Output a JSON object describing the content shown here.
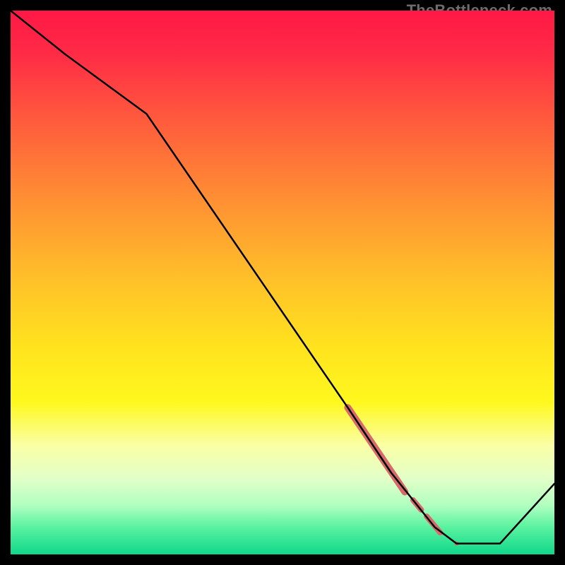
{
  "watermark": "TheBottleneck.com",
  "chart_data": {
    "type": "line",
    "title": "",
    "xlabel": "",
    "ylabel": "",
    "xlim": [
      0,
      100
    ],
    "ylim": [
      0,
      100
    ],
    "grid": false,
    "legend": false,
    "series": [
      {
        "name": "curve",
        "color": "#000000",
        "x": [
          0,
          10,
          25,
          62,
          70,
          74,
          78,
          82,
          90,
          100
        ],
        "y": [
          100,
          92,
          81,
          27,
          15,
          10,
          5,
          2,
          2,
          13
        ]
      }
    ],
    "highlights": [
      {
        "name": "thick-segment-1",
        "x": [
          62,
          72.5
        ],
        "y": [
          27,
          11.5
        ],
        "width": 10,
        "color": "#d76a6a"
      },
      {
        "name": "thick-segment-2",
        "x": [
          74,
          75.5
        ],
        "y": [
          10,
          8.2
        ],
        "width": 8,
        "color": "#d76a6a"
      },
      {
        "name": "thick-segment-3",
        "x": [
          76.5,
          79
        ],
        "y": [
          7,
          4
        ],
        "width": 8,
        "color": "#d76a6a"
      },
      {
        "name": "dot-1",
        "x": [
          82
        ],
        "y": [
          2
        ],
        "width": 6,
        "color": "#d76a6a"
      }
    ],
    "background_gradient": {
      "type": "vertical",
      "stops": [
        {
          "pos": 0.0,
          "color": "#ff1846"
        },
        {
          "pos": 0.08,
          "color": "#ff2b46"
        },
        {
          "pos": 0.2,
          "color": "#ff5a3d"
        },
        {
          "pos": 0.35,
          "color": "#ff9033"
        },
        {
          "pos": 0.5,
          "color": "#ffc229"
        },
        {
          "pos": 0.62,
          "color": "#ffe31e"
        },
        {
          "pos": 0.72,
          "color": "#fff81e"
        },
        {
          "pos": 0.8,
          "color": "#faffa6"
        },
        {
          "pos": 0.86,
          "color": "#e3ffc8"
        },
        {
          "pos": 0.91,
          "color": "#b0ffc0"
        },
        {
          "pos": 0.95,
          "color": "#59f2a0"
        },
        {
          "pos": 1.0,
          "color": "#10d78a"
        }
      ]
    }
  }
}
